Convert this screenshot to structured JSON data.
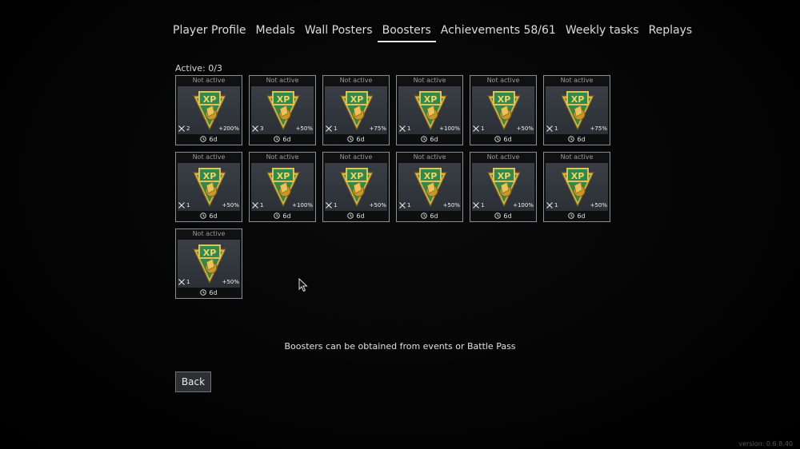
{
  "tabs": [
    {
      "label": "Player Profile",
      "name": "tab-player-profile",
      "active": false
    },
    {
      "label": "Medals",
      "name": "tab-medals",
      "active": false
    },
    {
      "label": "Wall Posters",
      "name": "tab-wall-posters",
      "active": false
    },
    {
      "label": "Boosters",
      "name": "tab-boosters",
      "active": true
    },
    {
      "label": "Achievements 58/61",
      "name": "tab-achievements",
      "active": false
    },
    {
      "label": "Weekly tasks",
      "name": "tab-weekly-tasks",
      "active": false
    },
    {
      "label": "Replays",
      "name": "tab-replays",
      "active": false
    }
  ],
  "active_count": "Active: 0/3",
  "boosters": [
    {
      "status": "Not active",
      "uses": "2",
      "bonus": "+200%",
      "time": "6d"
    },
    {
      "status": "Not active",
      "uses": "3",
      "bonus": "+50%",
      "time": "6d"
    },
    {
      "status": "Not active",
      "uses": "1",
      "bonus": "+75%",
      "time": "6d"
    },
    {
      "status": "Not active",
      "uses": "1",
      "bonus": "+100%",
      "time": "6d"
    },
    {
      "status": "Not active",
      "uses": "1",
      "bonus": "+50%",
      "time": "6d"
    },
    {
      "status": "Not active",
      "uses": "1",
      "bonus": "+75%",
      "time": "6d"
    },
    {
      "status": "Not active",
      "uses": "1",
      "bonus": "+50%",
      "time": "6d"
    },
    {
      "status": "Not active",
      "uses": "1",
      "bonus": "+100%",
      "time": "6d"
    },
    {
      "status": "Not active",
      "uses": "1",
      "bonus": "+50%",
      "time": "6d"
    },
    {
      "status": "Not active",
      "uses": "1",
      "bonus": "+50%",
      "time": "6d"
    },
    {
      "status": "Not active",
      "uses": "1",
      "bonus": "+100%",
      "time": "6d"
    },
    {
      "status": "Not active",
      "uses": "1",
      "bonus": "+50%",
      "time": "6d"
    },
    {
      "status": "Not active",
      "uses": "1",
      "bonus": "+50%",
      "time": "6d"
    }
  ],
  "booster_badge_text": "XP",
  "info_text": "Boosters can be obtained from events or Battle Pass",
  "back_label": "Back",
  "version": "version: 0.6.8.40",
  "colors": {
    "badge_green": "#2e8b4a",
    "badge_gold": "#d4a93a",
    "card_border": "#8a8f94"
  }
}
